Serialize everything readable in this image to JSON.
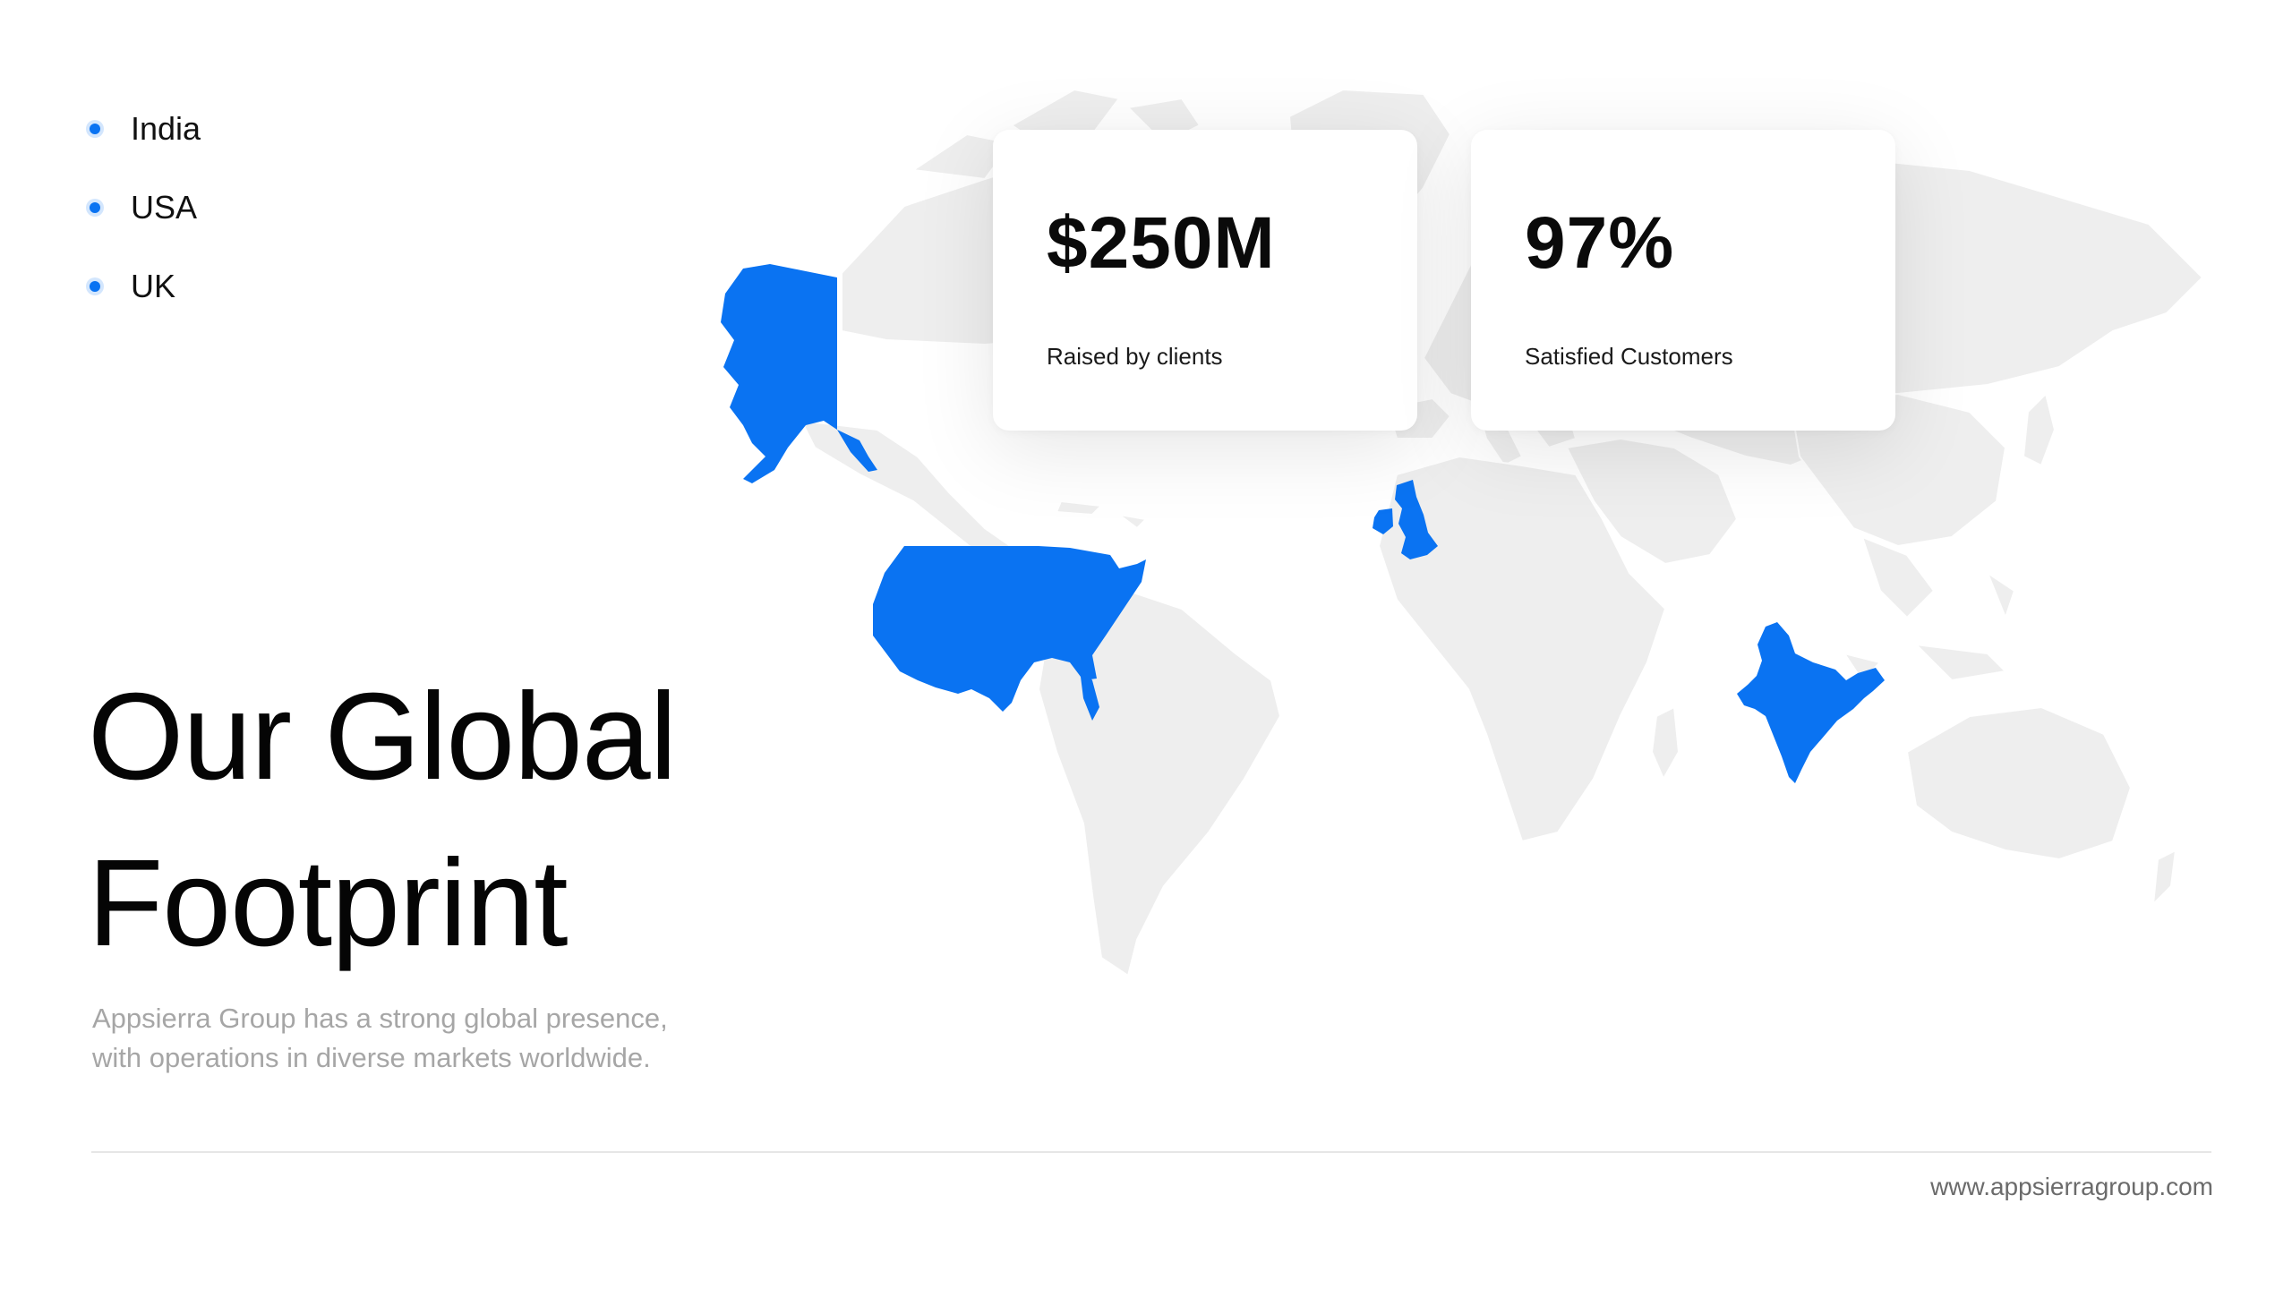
{
  "locations": [
    {
      "label": "India"
    },
    {
      "label": "USA"
    },
    {
      "label": "UK"
    }
  ],
  "stats": [
    {
      "value": "$250M",
      "caption": "Raised by clients"
    },
    {
      "value": "97%",
      "caption": "Satisfied Customers"
    }
  ],
  "headline": {
    "line1": "Our Global",
    "line2": "Footprint"
  },
  "description": {
    "line1": "Appsierra Group has a strong global presence,",
    "line2": "with operations in diverse markets worldwide."
  },
  "footer": {
    "website": "www.appsierragroup.com"
  },
  "colors": {
    "accent": "#0A73F2",
    "land": "#EEEEEE",
    "border": "#FFFFFF"
  },
  "highlighted_countries": [
    "USA",
    "UK",
    "India"
  ]
}
